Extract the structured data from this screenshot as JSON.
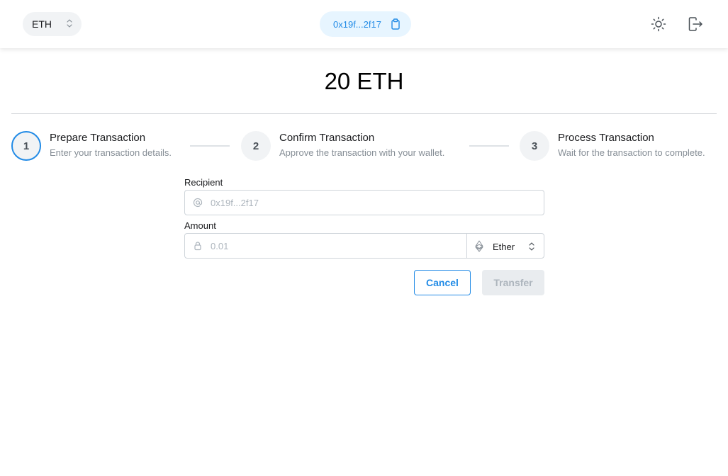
{
  "header": {
    "network": "ETH",
    "address": "0x19f...2f17"
  },
  "balance": "20 ETH",
  "steps": [
    {
      "number": "1",
      "title": "Prepare Transaction",
      "description": "Enter your transaction details."
    },
    {
      "number": "2",
      "title": "Confirm Transaction",
      "description": "Approve the transaction with your wallet."
    },
    {
      "number": "3",
      "title": "Process Transaction",
      "description": "Wait for the transaction to complete."
    }
  ],
  "form": {
    "recipient_label": "Recipient",
    "recipient_placeholder": "0x19f...2f17",
    "amount_label": "Amount",
    "amount_placeholder": "0.01",
    "unit": "Ether"
  },
  "buttons": {
    "cancel": "Cancel",
    "transfer": "Transfer"
  },
  "colors": {
    "accent": "#228be6",
    "address_bg": "#e7f5ff",
    "disabled_bg": "#e9ecef"
  }
}
